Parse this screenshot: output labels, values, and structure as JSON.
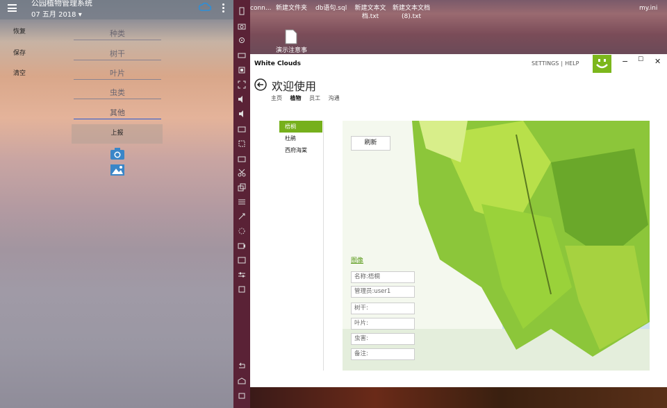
{
  "left_app": {
    "title": "公园植物管理系统",
    "date": "07 五月 2018",
    "side_buttons": [
      "恢复",
      "保存",
      "清空"
    ],
    "fields": [
      {
        "placeholder": "种类"
      },
      {
        "placeholder": "树干"
      },
      {
        "placeholder": "叶片"
      },
      {
        "placeholder": "虫类"
      },
      {
        "value": "其他"
      }
    ],
    "report_label": "上报"
  },
  "desktop": {
    "icons": [
      "conn...",
      "新建文件夹",
      "db语句.sql",
      "新建文本文档.txt",
      "新建文本文档 (8).txt",
      "my.ini",
      "演示注意事"
    ]
  },
  "window": {
    "title": "White Clouds",
    "links": [
      "SETTINGS",
      "HELP"
    ],
    "welcome": "欢迎使用",
    "tabs": [
      "主页",
      "植物",
      "员工",
      "沟通"
    ],
    "active_tab": "植物",
    "tree": [
      "梧桐",
      "杜鹃",
      "西府海棠"
    ],
    "refresh_label": "刷新",
    "image_link": "图像",
    "info_fields": [
      "名称:梧桐",
      "管理员:user1",
      "树干:",
      "叶片:",
      "虫害:",
      "备注:"
    ]
  },
  "colors": {
    "accent_green": "#76b01c",
    "taskbar": "#5a2236"
  }
}
